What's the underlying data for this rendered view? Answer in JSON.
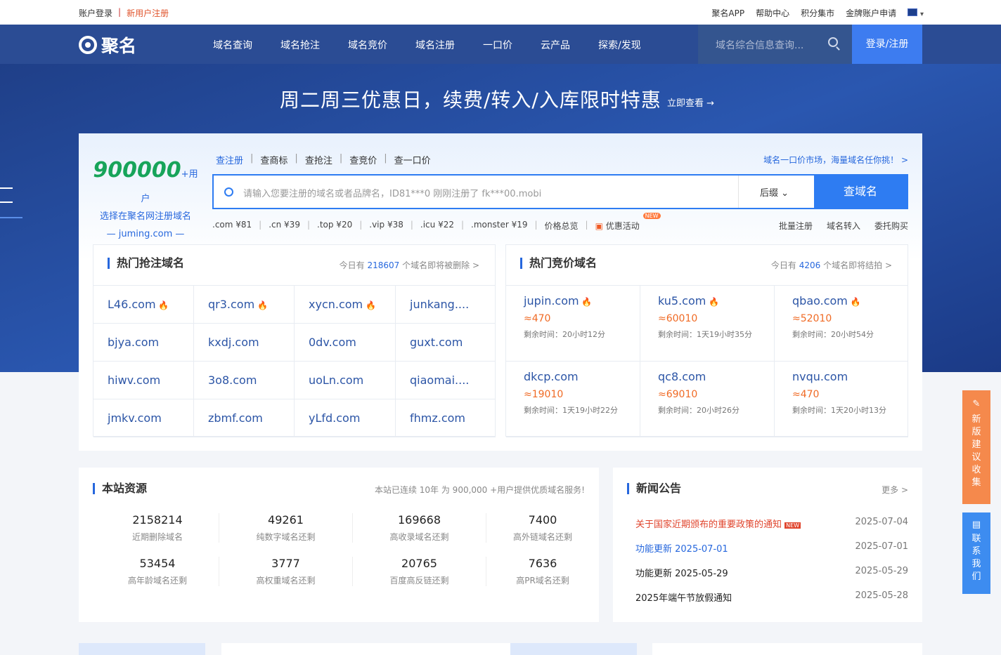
{
  "topbar": {
    "account_login": "账户登录",
    "register": "新用户注册",
    "links": [
      "聚名APP",
      "帮助中心",
      "积分集市",
      "金牌账户申请"
    ]
  },
  "nav": {
    "logo": "聚名",
    "items": [
      "域名查询",
      "域名抢注",
      "域名竞价",
      "域名注册",
      "一口价",
      "云产品",
      "探索/发现"
    ],
    "search_placeholder": "域名综合信息查询...",
    "login": "登录/注册"
  },
  "hero": {
    "promo": "周二周三优惠日，续费/转入/入库限时特惠",
    "promo_link": "立即查看 →"
  },
  "search_card": {
    "user_count": "900000",
    "user_suffix": "+用户",
    "slogan": "选择在聚名网注册域名",
    "site": "— juming.com —",
    "tabs": [
      "查注册",
      "查商标",
      "查抢注",
      "查竞价",
      "查一口价"
    ],
    "market_link": "域名一口价市场，海量域名任你挑！ >",
    "placeholder": "请输入您要注册的域名或者品牌名，ID81***0 刚刚注册了 fk***00.mobi",
    "suffix_label": "后缀",
    "search_button": "查域名",
    "prices": [
      ".com ¥81",
      ".cn ¥39",
      ".top ¥20",
      ".vip ¥38",
      ".icu ¥22",
      ".monster ¥19",
      "价格总览"
    ],
    "activity": "优惠活动",
    "new_badge": "NEW",
    "quick_links": [
      "批量注册",
      "域名转入",
      "委托购买"
    ]
  },
  "hot_snatch": {
    "title": "热门抢注域名",
    "info_prefix": "今日有",
    "count": "218607",
    "info_suffix": "个域名即将被删除 >",
    "domains": [
      "L46.com",
      "qr3.com",
      "xycn.com",
      "junkang....",
      "bjya.com",
      "kxdj.com",
      "0dv.com",
      "guxt.com",
      "hiwv.com",
      "3o8.com",
      "uoLn.com",
      "qiaomai....",
      "jmkv.com",
      "zbmf.com",
      "yLfd.com",
      "fhmz.com"
    ],
    "hot": [
      true,
      true,
      true,
      false,
      false,
      false,
      false,
      false,
      false,
      false,
      false,
      false,
      false,
      false,
      false,
      false
    ]
  },
  "hot_auction": {
    "title": "热门竞价域名",
    "info_prefix": "今日有",
    "count": "4206",
    "info_suffix": "个域名即将结拍 >",
    "items": [
      {
        "domain": "jupin.com",
        "price": "≈470",
        "time": "剩余时间：20小时12分",
        "hot": true
      },
      {
        "domain": "ku5.com",
        "price": "≈60010",
        "time": "剩余时间：1天19小时35分",
        "hot": true
      },
      {
        "domain": "qbao.com",
        "price": "≈52010",
        "time": "剩余时间：20小时54分",
        "hot": true
      },
      {
        "domain": "dkcp.com",
        "price": "≈19010",
        "time": "剩余时间：1天19小时22分",
        "hot": false
      },
      {
        "domain": "qc8.com",
        "price": "≈69010",
        "time": "剩余时间：20小时26分",
        "hot": false
      },
      {
        "domain": "nvqu.com",
        "price": "≈470",
        "time": "剩余时间：1天20小时13分",
        "hot": false
      }
    ]
  },
  "resources": {
    "title": "本站资源",
    "info": "本站已连续 10年 为 900,000 +用户提供优质域名服务!",
    "stats": [
      {
        "value": "2158214",
        "label": "近期删除域名"
      },
      {
        "value": "49261",
        "label": "纯数字域名还剩"
      },
      {
        "value": "169668",
        "label": "高收录域名还剩"
      },
      {
        "value": "7400",
        "label": "高外链域名还剩"
      },
      {
        "value": "53454",
        "label": "高年龄域名还剩"
      },
      {
        "value": "3777",
        "label": "高权重域名还剩"
      },
      {
        "value": "20765",
        "label": "百度高反链还剩"
      },
      {
        "value": "7636",
        "label": "高PR域名还剩"
      }
    ]
  },
  "news": {
    "title": "新闻公告",
    "more": "更多 >",
    "items": [
      {
        "title": "关于国家近期颁布的重要政策的通知",
        "date": "2025-07-04",
        "color": "#e0442c",
        "new": true
      },
      {
        "title": "功能更新 2025-07-01",
        "date": "2025-07-01",
        "color": "#2667dd",
        "new": false
      },
      {
        "title": "功能更新 2025-05-29",
        "date": "2025-05-29",
        "color": "#222222",
        "new": false
      },
      {
        "title": "2025年端午节放假通知",
        "date": "2025-05-28",
        "color": "#222222",
        "new": false
      }
    ]
  },
  "side": {
    "feedback": "新版建议收集",
    "contact": "联系我们"
  }
}
